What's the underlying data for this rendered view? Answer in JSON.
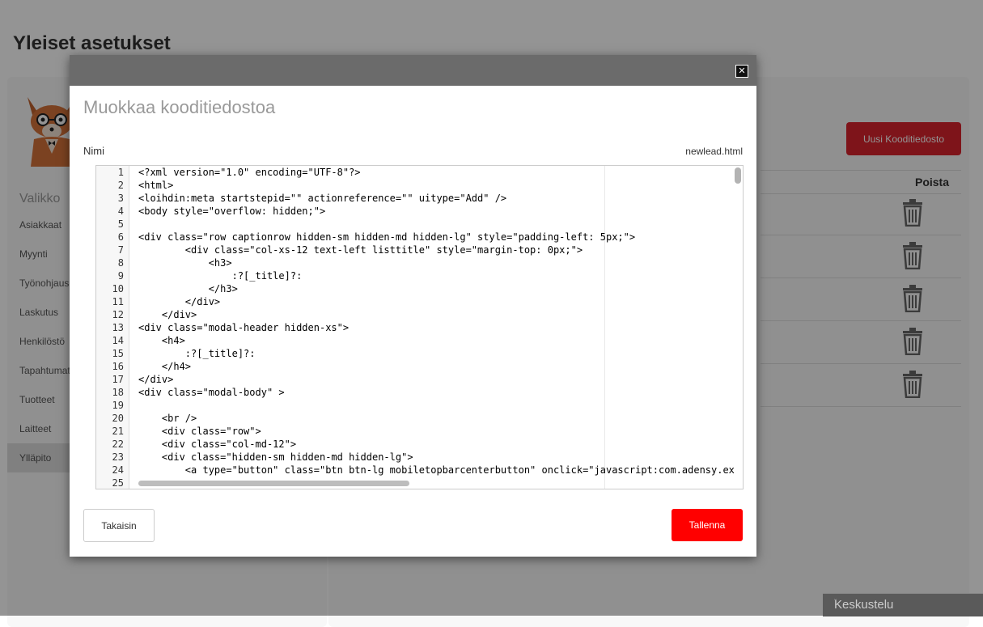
{
  "page": {
    "title": "Yleiset asetukset",
    "menu_heading": "Valikko",
    "menu": [
      "Asiakkaat",
      "Myynti",
      "Työnohjaus",
      "Laskutus",
      "Henkilöstö",
      "Tapahtumat",
      "Tuotteet",
      "Laitteet",
      "Ylläpito"
    ],
    "active_menu": "Ylläpito",
    "new_file_button": "Uusi Kooditiedosto",
    "delete_column": "Poista",
    "row_count": 5,
    "chat_label": "Keskustelu"
  },
  "modal": {
    "title": "Muokkaa kooditiedostoa",
    "close_icon": "close-icon",
    "name_label": "Nimi",
    "name_value": "newlead.html",
    "back_button": "Takaisin",
    "save_button": "Tallenna",
    "code_lines": [
      "<?xml version=\"1.0\" encoding=\"UTF-8\"?>",
      "<html>",
      "<loihdin:meta startstepid=\"\" actionreference=\"\" uitype=\"Add\" />",
      "<body style=\"overflow: hidden;\">",
      "",
      "<div class=\"row captionrow hidden-sm hidden-md hidden-lg\" style=\"padding-left: 5px;\">",
      "        <div class=\"col-xs-12 text-left listtitle\" style=\"margin-top: 0px;\">",
      "            <h3>",
      "                :?[_title]?:",
      "            </h3>",
      "        </div>",
      "    </div>",
      "<div class=\"modal-header hidden-xs\">",
      "    <h4>",
      "        :?[_title]?:",
      "    </h4>",
      "</div>",
      "<div class=\"modal-body\" >",
      "",
      "    <br />",
      "    <div class=\"row\">",
      "    <div class=\"col-md-12\">",
      "    <div class=\"hidden-sm hidden-md hidden-lg\">",
      "        <a type=\"button\" class=\"btn btn-lg mobiletopbarcenterbutton\" onclick=\"javascript:com.adensy.ex",
      ""
    ]
  },
  "colors": {
    "accent_red": "#ff0000",
    "brand_red": "#d9232d"
  }
}
